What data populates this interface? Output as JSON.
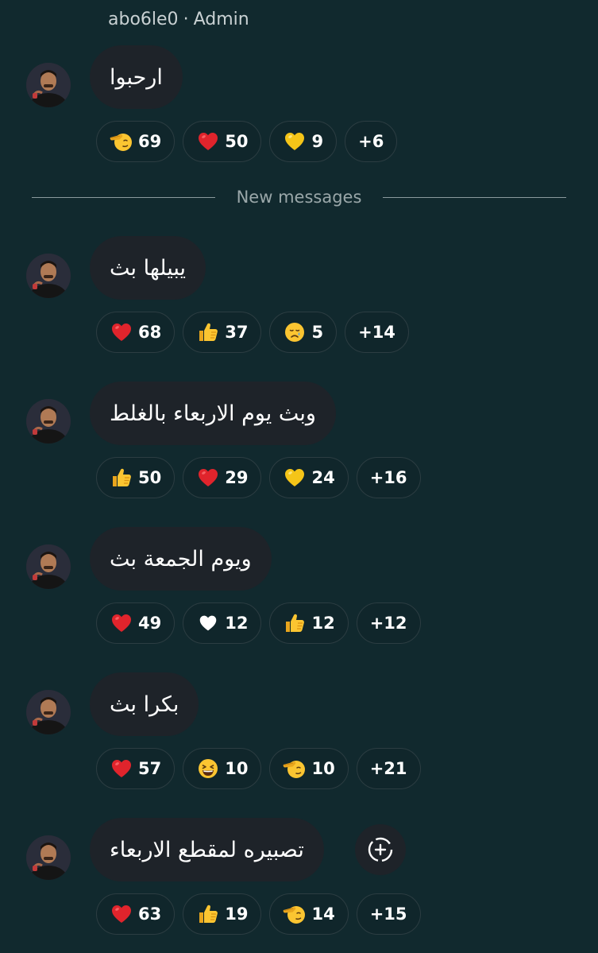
{
  "header": {
    "sender_name": "abo6le0",
    "separator": "·",
    "role": "Admin"
  },
  "divider": {
    "label": "New messages"
  },
  "messages": [
    {
      "text": "ارحبوا",
      "reactions": [
        {
          "icon": "saluting-face",
          "count": "69"
        },
        {
          "icon": "red-heart",
          "count": "50"
        },
        {
          "icon": "yellow-heart",
          "count": "9"
        }
      ],
      "more": "+6"
    },
    {
      "text": "يبيلها بث",
      "reactions": [
        {
          "icon": "red-heart",
          "count": "68"
        },
        {
          "icon": "thumbs-up",
          "count": "37"
        },
        {
          "icon": "crying-face",
          "count": "5"
        }
      ],
      "more": "+14"
    },
    {
      "text": "وبث يوم الاربعاء بالغلط",
      "reactions": [
        {
          "icon": "thumbs-up",
          "count": "50"
        },
        {
          "icon": "red-heart",
          "count": "29"
        },
        {
          "icon": "yellow-heart",
          "count": "24"
        }
      ],
      "more": "+16"
    },
    {
      "text": "ويوم الجمعة بث",
      "reactions": [
        {
          "icon": "red-heart",
          "count": "49"
        },
        {
          "icon": "white-heart",
          "count": "12"
        },
        {
          "icon": "thumbs-up",
          "count": "12"
        }
      ],
      "more": "+12"
    },
    {
      "text": "بكرا بث",
      "reactions": [
        {
          "icon": "red-heart",
          "count": "57"
        },
        {
          "icon": "laughing-face",
          "count": "10"
        },
        {
          "icon": "saluting-face",
          "count": "10"
        }
      ],
      "more": "+21"
    },
    {
      "text": "تصبيره لمقطع الاربعاء",
      "reactions": [
        {
          "icon": "red-heart",
          "count": "63"
        },
        {
          "icon": "thumbs-up",
          "count": "19"
        },
        {
          "icon": "saluting-face",
          "count": "14"
        }
      ],
      "more": "+15",
      "has_add_reaction": true
    }
  ],
  "colors": {
    "background": "#11292e",
    "bubble": "#1e2329",
    "pill_border": "#2c3d42",
    "divider_text": "#9aa7a9"
  }
}
